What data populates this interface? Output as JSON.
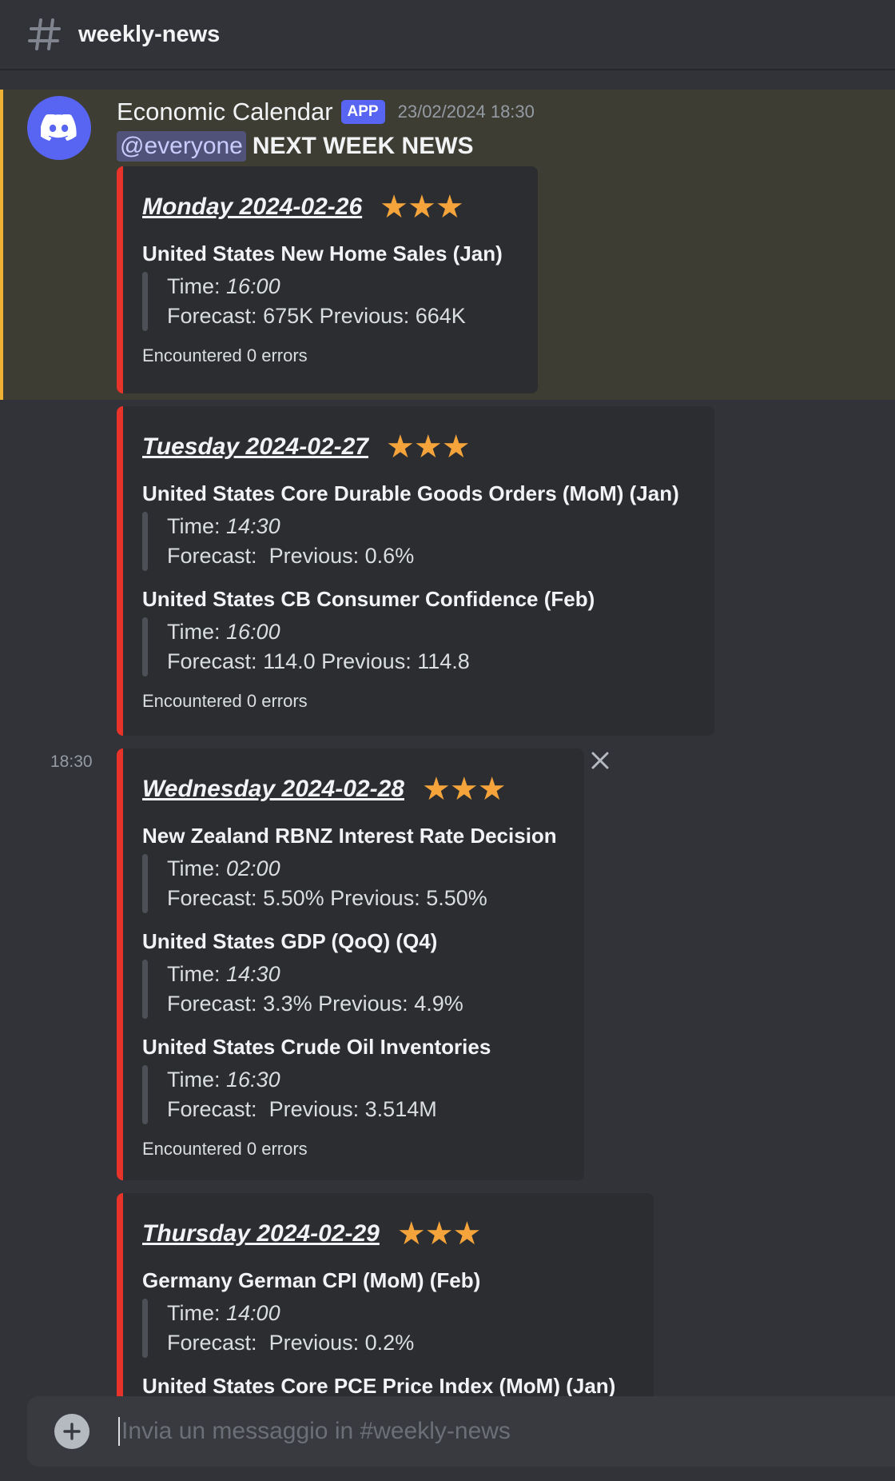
{
  "header": {
    "channel": "weekly-news"
  },
  "message": {
    "author": "Economic Calendar",
    "badge": "APP",
    "timestamp": "23/02/2024 18:30",
    "mention": "@everyone",
    "headline": "NEXT WEEK NEWS",
    "side_time": "18:30"
  },
  "labels": {
    "time": "Time:",
    "forecast": "Forecast:",
    "previous": "Previous:"
  },
  "stars": "★★★",
  "embeds": [
    {
      "day": "Monday 2024-02-26",
      "events": [
        {
          "title": "United States New Home Sales  (Jan)",
          "time": "16:00",
          "forecast": "675K",
          "previous": "664K"
        }
      ],
      "footer": "Encountered 0 errors"
    },
    {
      "day": "Tuesday 2024-02-27",
      "events": [
        {
          "title": "United States Core Durable Goods Orders (MoM)  (Jan)",
          "time": "14:30",
          "forecast": "",
          "previous": "0.6%"
        },
        {
          "title": "United States CB Consumer Confidence  (Feb)",
          "time": "16:00",
          "forecast": "114.0",
          "previous": "114.8"
        }
      ],
      "footer": "Encountered 0 errors"
    },
    {
      "day": "Wednesday 2024-02-28",
      "events": [
        {
          "title": "New Zealand RBNZ Interest Rate Decision",
          "time": "02:00",
          "forecast": "5.50%",
          "previous": "5.50%"
        },
        {
          "title": "United States GDP (QoQ)  (Q4)",
          "time": "14:30",
          "forecast": "3.3%",
          "previous": "4.9%"
        },
        {
          "title": "United States Crude Oil Inventories",
          "time": "16:30",
          "forecast": "",
          "previous": "3.514M"
        }
      ],
      "footer": "Encountered 0 errors"
    },
    {
      "day": "Thursday 2024-02-29",
      "events": [
        {
          "title": "Germany German CPI (MoM)  (Feb)",
          "time": "14:00",
          "forecast": "",
          "previous": "0.2%"
        },
        {
          "title": "United States Core PCE Price Index (MoM)  (Jan)"
        }
      ]
    }
  ],
  "composer": {
    "placeholder": "Invia un messaggio in #weekly-news"
  },
  "colors": {
    "accent": "#5865f2",
    "embed_bar": "#e8332a",
    "star": "#f4a43a",
    "highlight_bar": "#f0b232"
  },
  "icons": {
    "channel": "hash-icon",
    "avatar": "discord-logo-icon",
    "close": "close-icon",
    "add": "plus-icon"
  }
}
